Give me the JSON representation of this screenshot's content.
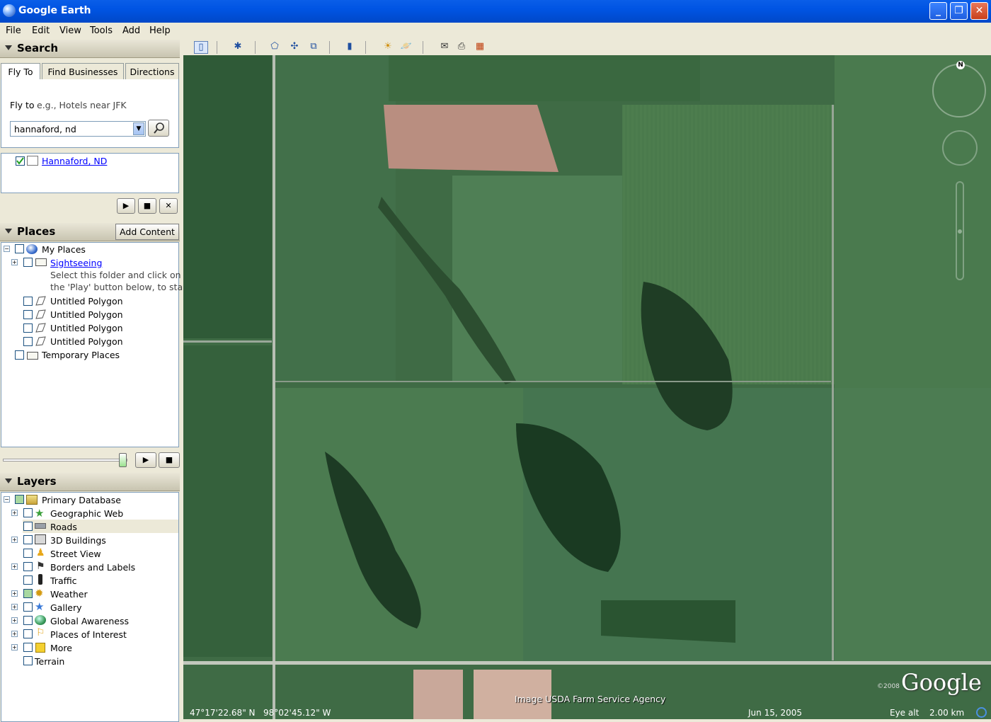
{
  "window": {
    "title": "Google Earth"
  },
  "menu": [
    "File",
    "Edit",
    "View",
    "Tools",
    "Add",
    "Help"
  ],
  "search": {
    "header": "Search",
    "tabs": [
      "Fly To",
      "Find Businesses",
      "Directions"
    ],
    "fly_to_label": "Fly to",
    "fly_to_hint": "e.g., Hotels near JFK",
    "query": "hannaford, nd",
    "result": "Hannaford, ND"
  },
  "places": {
    "header": "Places",
    "add_content": "Add Content",
    "my_places": "My Places",
    "sightseeing": "Sightseeing",
    "sightseeing_desc_1": "Select this folder and click on",
    "sightseeing_desc_2": "the 'Play' button below, to start",
    "polygons": [
      "Untitled Polygon",
      "Untitled Polygon",
      "Untitled Polygon",
      "Untitled Polygon"
    ],
    "temporary": "Temporary Places"
  },
  "layers": {
    "header": "Layers",
    "primary": "Primary Database",
    "items": [
      "Geographic Web",
      "Roads",
      "3D Buildings",
      "Street View",
      "Borders and Labels",
      "Traffic",
      "Weather",
      "Gallery",
      "Global Awareness",
      "Places of Interest",
      "More"
    ],
    "terrain": "Terrain"
  },
  "map": {
    "attribution": "Image USDA Farm Service Agency",
    "copyright": "©2008",
    "logo": "Google",
    "latitude": "47°17'22.68\" N",
    "longitude": "98°02'45.12\" W",
    "date": "Jun 15, 2005",
    "eye_alt_label": "Eye alt",
    "eye_alt_value": "2.00 km",
    "compass_north": "N"
  },
  "colors": {
    "titlebar": "#0054e3",
    "link": "#0000ff",
    "map_green": "#3f6b45"
  }
}
